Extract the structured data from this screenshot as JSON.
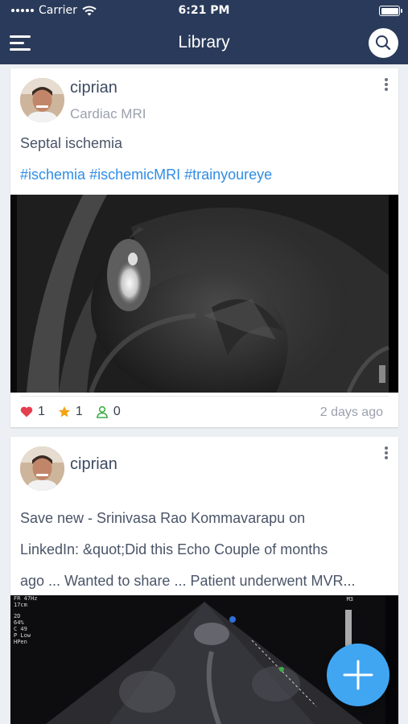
{
  "status_bar": {
    "carrier": "Carrier",
    "time": "6:21 PM"
  },
  "nav": {
    "title": "Library"
  },
  "posts": [
    {
      "author": "ciprian",
      "category": "Cardiac MRI",
      "text": "Septal ischemia",
      "tags": [
        "#ischemia",
        "#ischemicMRI",
        "#trainyoureye"
      ],
      "likes": "1",
      "stars": "1",
      "followers": "0",
      "age": "2 days ago"
    },
    {
      "author": "ciprian",
      "text_lines": [
        "Save new - Srinivasa Rao Kommavarapu on",
        "LinkedIn: &quot;Did this Echo Couple of months",
        "ago ... Wanted to share ... Patient underwent MVR..."
      ],
      "echo_overlay": [
        "FR 47Hz",
        "17cm",
        "2D",
        "64%",
        "C 49",
        "P Low",
        "HPen"
      ],
      "echo_corner": "M3"
    }
  ],
  "colors": {
    "nav_bg": "#2a3a5a",
    "hashtag": "#2f8de4",
    "heart": "#e53e4f",
    "star": "#f2a413",
    "follow": "#3fae49",
    "fab": "#41a6f2"
  },
  "icons": {
    "menu": "hamburger-icon",
    "search": "search-icon",
    "more": "kebab-icon",
    "like": "heart-icon",
    "star": "star-icon",
    "follow": "user-icon",
    "add": "plus-icon"
  }
}
